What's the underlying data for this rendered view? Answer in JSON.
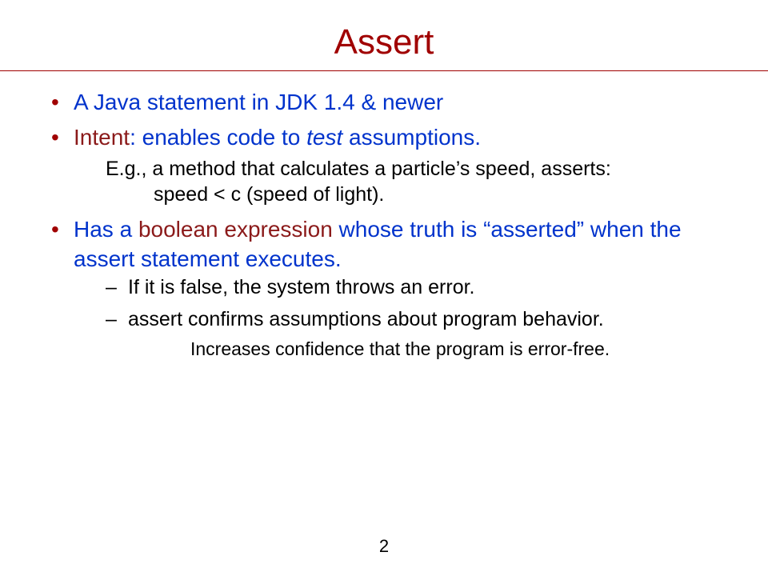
{
  "title": "Assert",
  "bullets": {
    "b1": "A Java statement in JDK 1.4 & newer",
    "b2": {
      "intent": "Intent",
      "rest": ": enables code to ",
      "test": "test",
      "end": " assumptions."
    },
    "b2_sub_line1": "E.g., a method that calculates a particle’s speed, asserts:",
    "b2_sub_line2": "speed < c (speed of light).",
    "b3": {
      "pre": "Has a ",
      "bool": "boolean expression",
      "post": " whose truth is “asserted” when the assert statement executes."
    },
    "b3_d1": "If it is false, the system throws an error.",
    "b3_d2": "assert confirms assumptions about program behavior.",
    "b3_d2_sub": "Increases confidence that the program is error-free."
  },
  "page_number": "2"
}
